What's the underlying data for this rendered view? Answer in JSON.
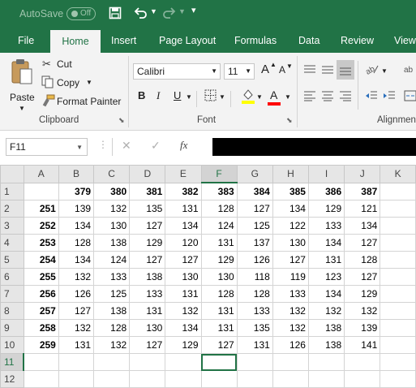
{
  "titlebar": {
    "autosave_label": "AutoSave",
    "autosave_state": "Off",
    "save_icon": "save-icon",
    "undo_icon": "undo-icon",
    "redo_icon": "redo-icon",
    "customize_icon": "customize-qat-icon"
  },
  "tabs": [
    "File",
    "Home",
    "Insert",
    "Page Layout",
    "Formulas",
    "Data",
    "Review",
    "View"
  ],
  "active_tab": "Home",
  "clipboard": {
    "paste_label": "Paste",
    "cut_label": "Cut",
    "copy_label": "Copy",
    "format_painter_label": "Format Painter",
    "group_label": "Clipboard"
  },
  "font": {
    "name": "Calibri",
    "size": "11",
    "bold": "B",
    "italic": "I",
    "underline": "U",
    "grow_font": "A",
    "shrink_font": "A",
    "font_color_letter": "A",
    "group_label": "Font"
  },
  "alignment": {
    "group_label": "Alignmen"
  },
  "namebox": {
    "value": "F11"
  },
  "formula": {
    "fx_label": "fx",
    "value": ""
  },
  "colors": {
    "brand": "#217346",
    "fill": "#ffff00",
    "font_color": "#ff0000",
    "formula_bar": "#000000"
  },
  "sheet": {
    "columns": [
      "A",
      "B",
      "C",
      "D",
      "E",
      "F",
      "G",
      "H",
      "I",
      "J",
      "K"
    ],
    "selected_column": "F",
    "selected_row": "11",
    "rows": [
      {
        "row": "1",
        "cells": [
          "",
          "379",
          "380",
          "381",
          "382",
          "383",
          "384",
          "385",
          "386",
          "387",
          ""
        ]
      },
      {
        "row": "2",
        "cells": [
          "251",
          "139",
          "132",
          "135",
          "131",
          "128",
          "127",
          "134",
          "129",
          "121",
          ""
        ]
      },
      {
        "row": "3",
        "cells": [
          "252",
          "134",
          "130",
          "127",
          "134",
          "124",
          "125",
          "122",
          "133",
          "134",
          ""
        ]
      },
      {
        "row": "4",
        "cells": [
          "253",
          "128",
          "138",
          "129",
          "120",
          "131",
          "137",
          "130",
          "134",
          "127",
          ""
        ]
      },
      {
        "row": "5",
        "cells": [
          "254",
          "134",
          "124",
          "127",
          "127",
          "129",
          "126",
          "127",
          "131",
          "128",
          ""
        ]
      },
      {
        "row": "6",
        "cells": [
          "255",
          "132",
          "133",
          "138",
          "130",
          "130",
          "118",
          "119",
          "123",
          "127",
          ""
        ]
      },
      {
        "row": "7",
        "cells": [
          "256",
          "126",
          "125",
          "133",
          "131",
          "128",
          "128",
          "133",
          "134",
          "129",
          ""
        ]
      },
      {
        "row": "8",
        "cells": [
          "257",
          "127",
          "138",
          "131",
          "132",
          "131",
          "133",
          "132",
          "132",
          "132",
          ""
        ]
      },
      {
        "row": "9",
        "cells": [
          "258",
          "132",
          "128",
          "130",
          "134",
          "131",
          "135",
          "132",
          "138",
          "139",
          ""
        ]
      },
      {
        "row": "10",
        "cells": [
          "259",
          "131",
          "132",
          "127",
          "129",
          "127",
          "131",
          "126",
          "138",
          "141",
          ""
        ]
      },
      {
        "row": "11",
        "cells": [
          "",
          "",
          "",
          "",
          "",
          "",
          "",
          "",
          "",
          "",
          ""
        ]
      },
      {
        "row": "12",
        "cells": [
          "",
          "",
          "",
          "",
          "",
          "",
          "",
          "",
          "",
          "",
          ""
        ]
      }
    ]
  }
}
